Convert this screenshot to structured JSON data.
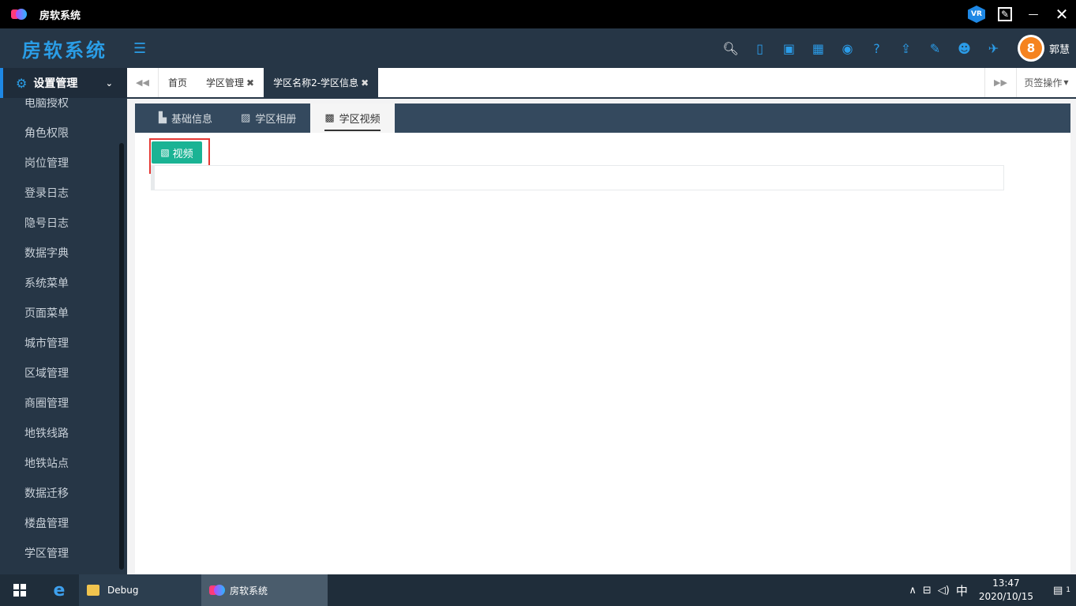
{
  "window": {
    "title": "房软系统",
    "vr_label": "VR"
  },
  "header": {
    "brand": "房软系统",
    "username": "郭慧",
    "avatar_badge": "8",
    "icons": [
      "search-icon",
      "mobile-icon",
      "contact-card-icon",
      "grid-icon",
      "map-pin-icon",
      "help-icon",
      "upload-icon",
      "edit-icon",
      "user-icon",
      "run-icon"
    ]
  },
  "sidebar": {
    "group": "设置管理",
    "items": [
      "电脑授权",
      "角色权限",
      "岗位管理",
      "登录日志",
      "隐号日志",
      "数据字典",
      "系统菜单",
      "页面菜单",
      "城市管理",
      "区域管理",
      "商圈管理",
      "地铁线路",
      "地铁站点",
      "数据迁移",
      "楼盘管理",
      "学区管理"
    ]
  },
  "page_tabs": {
    "tabs": [
      {
        "label": "首页",
        "closable": false,
        "active": false
      },
      {
        "label": "学区管理",
        "closable": true,
        "active": false
      },
      {
        "label": "学区名称2-学区信息",
        "closable": true,
        "active": true
      }
    ],
    "ops_label": "页签操作"
  },
  "inner_tabs": [
    {
      "label": "基础信息",
      "icon": "building-icon",
      "active": false
    },
    {
      "label": "学区相册",
      "icon": "picture-icon",
      "active": false
    },
    {
      "label": "学区视频",
      "icon": "video-icon",
      "active": true
    }
  ],
  "content": {
    "video_button": "视频"
  },
  "taskbar": {
    "folder_label": "Debug",
    "running_app": "房软系统",
    "ime": "中",
    "time": "13:47",
    "date": "2020/10/15",
    "notification_count": "1"
  }
}
